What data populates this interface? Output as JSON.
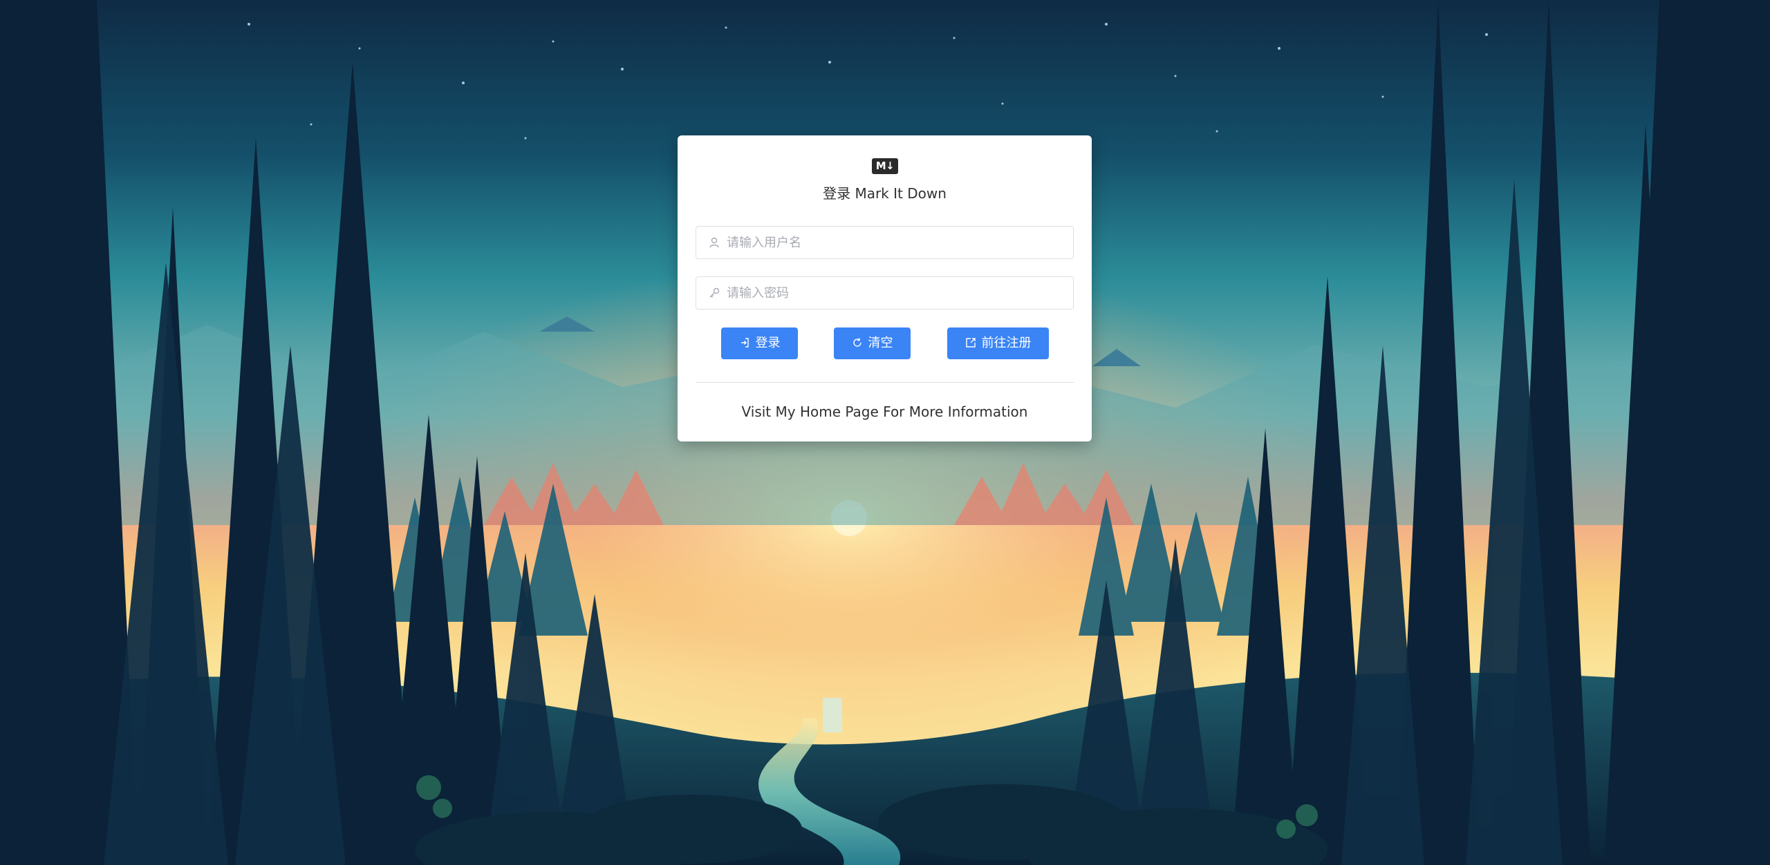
{
  "login": {
    "logo_text": "M↓",
    "title": "登录 Mark It Down",
    "username": {
      "placeholder": "请输入用户名",
      "value": "",
      "icon": "user-icon"
    },
    "password": {
      "placeholder": "请输入密码",
      "value": "",
      "icon": "key-icon"
    },
    "buttons": {
      "login": {
        "label": "登录",
        "icon": "login-icon"
      },
      "clear": {
        "label": "清空",
        "icon": "refresh-icon"
      },
      "register": {
        "label": "前往注册",
        "icon": "external-icon"
      }
    },
    "home_link": "Visit My Home Page For More Information"
  },
  "colors": {
    "primary": "#3a84f5",
    "card_bg": "#ffffff",
    "text": "#303133",
    "placeholder": "#a8abb2",
    "border": "#dcdfe6"
  },
  "background": {
    "description_icon": "forest-sunset-illustration"
  }
}
